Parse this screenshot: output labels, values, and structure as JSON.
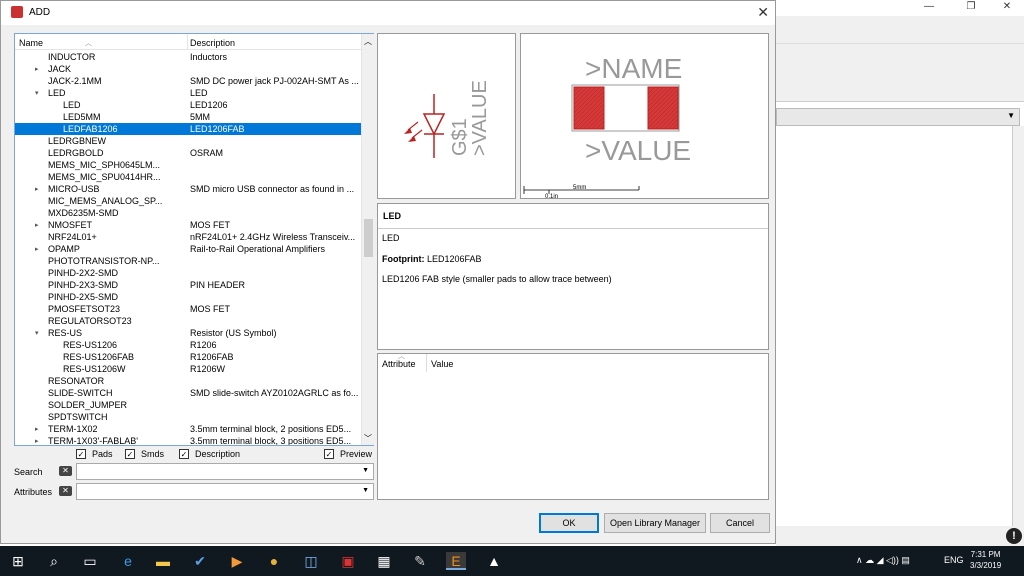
{
  "window": {
    "title": "ADD",
    "close_glyph": "✕"
  },
  "background": {
    "minimize": "—",
    "restore": "❐",
    "close": "✕",
    "info": "!"
  },
  "tree": {
    "headers": {
      "name": "Name",
      "description": "Description"
    },
    "rows": [
      {
        "name": "INDUCTOR",
        "desc": "Inductors",
        "indent": 0,
        "expander": ""
      },
      {
        "name": "JACK",
        "desc": "",
        "indent": 0,
        "expander": "▸"
      },
      {
        "name": "JACK-2.1MM",
        "desc": "SMD DC power jack PJ-002AH-SMT As ...",
        "indent": 0,
        "expander": ""
      },
      {
        "name": "LED",
        "desc": "LED",
        "indent": 0,
        "expander": "▾"
      },
      {
        "name": "LED",
        "desc": "LED1206",
        "indent": 1,
        "expander": ""
      },
      {
        "name": "LED5MM",
        "desc": "5MM",
        "indent": 1,
        "expander": ""
      },
      {
        "name": "LEDFAB1206",
        "desc": "LED1206FAB",
        "indent": 1,
        "expander": "",
        "selected": true
      },
      {
        "name": "LEDRGBNEW",
        "desc": "",
        "indent": 0,
        "expander": ""
      },
      {
        "name": "LEDRGBOLD",
        "desc": "OSRAM",
        "indent": 0,
        "expander": ""
      },
      {
        "name": "MEMS_MIC_SPH0645LM...",
        "desc": "",
        "indent": 0,
        "expander": ""
      },
      {
        "name": "MEMS_MIC_SPU0414HR...",
        "desc": "",
        "indent": 0,
        "expander": ""
      },
      {
        "name": "MICRO-USB",
        "desc": "SMD micro USB connector as found in ...",
        "indent": 0,
        "expander": "▸"
      },
      {
        "name": "MIC_MEMS_ANALOG_SP...",
        "desc": "",
        "indent": 0,
        "expander": ""
      },
      {
        "name": "MXD6235M-SMD",
        "desc": "",
        "indent": 0,
        "expander": ""
      },
      {
        "name": "NMOSFET",
        "desc": "MOS FET",
        "indent": 0,
        "expander": "▸"
      },
      {
        "name": "NRF24L01+",
        "desc": "nRF24L01+ 2.4GHz Wireless Transceiv...",
        "indent": 0,
        "expander": ""
      },
      {
        "name": "OPAMP",
        "desc": "Rail-to-Rail Operational Amplifiers",
        "indent": 0,
        "expander": "▸"
      },
      {
        "name": "PHOTOTRANSISTOR-NP...",
        "desc": "",
        "indent": 0,
        "expander": ""
      },
      {
        "name": "PINHD-2X2-SMD",
        "desc": "",
        "indent": 0,
        "expander": ""
      },
      {
        "name": "PINHD-2X3-SMD",
        "desc": "PIN HEADER",
        "indent": 0,
        "expander": ""
      },
      {
        "name": "PINHD-2X5-SMD",
        "desc": "",
        "indent": 0,
        "expander": ""
      },
      {
        "name": "PMOSFETSOT23",
        "desc": "MOS FET",
        "indent": 0,
        "expander": ""
      },
      {
        "name": "REGULATORSOT23",
        "desc": "",
        "indent": 0,
        "expander": ""
      },
      {
        "name": "RES-US",
        "desc": "Resistor (US Symbol)",
        "indent": 0,
        "expander": "▾"
      },
      {
        "name": "RES-US1206",
        "desc": "R1206",
        "indent": 1,
        "expander": ""
      },
      {
        "name": "RES-US1206FAB",
        "desc": "R1206FAB",
        "indent": 1,
        "expander": ""
      },
      {
        "name": "RES-US1206W",
        "desc": "R1206W",
        "indent": 1,
        "expander": ""
      },
      {
        "name": "RESONATOR",
        "desc": "",
        "indent": 0,
        "expander": ""
      },
      {
        "name": "SLIDE-SWITCH",
        "desc": "SMD slide-switch AYZ0102AGRLC as fo...",
        "indent": 0,
        "expander": ""
      },
      {
        "name": "SOLDER_JUMPER",
        "desc": "",
        "indent": 0,
        "expander": ""
      },
      {
        "name": "SPDTSWITCH",
        "desc": "",
        "indent": 0,
        "expander": ""
      },
      {
        "name": "TERM-1X02",
        "desc": "3.5mm terminal block, 2 positions ED5...",
        "indent": 0,
        "expander": "▸"
      },
      {
        "name": "TERM-1X03'-FABLAB'",
        "desc": "3.5mm terminal block, 3 positions ED5...",
        "indent": 0,
        "expander": "▸"
      }
    ]
  },
  "filters": {
    "pads": "Pads",
    "smds": "Smds",
    "description": "Description",
    "preview": "Preview",
    "check": "✓"
  },
  "search": {
    "label": "Search",
    "clear": "✕",
    "value": ""
  },
  "attributes_filter": {
    "label": "Attributes",
    "clear": "✕",
    "value": ""
  },
  "symbol": {
    "name_text": "G$1",
    "value_text": ">VALUE"
  },
  "package": {
    "name_text": ">NAME",
    "value_text": ">VALUE",
    "scale_mm": "5mm",
    "scale_in": "0.1in"
  },
  "details": {
    "title": "LED",
    "description": "LED",
    "footprint_label": "Footprint:",
    "footprint_value": "LED1206FAB",
    "note": "LED1206 FAB style (smaller pads to allow trace between)"
  },
  "attr_table": {
    "col_attribute": "Attribute",
    "col_value": "Value"
  },
  "buttons": {
    "ok": "OK",
    "open_library_manager": "Open Library Manager",
    "cancel": "Cancel"
  },
  "taskbar": {
    "time": "7:31 PM",
    "date": "3/3/2019",
    "language": "ENG",
    "tray": "∧ ☁ ◢ ◁)) ▤"
  }
}
